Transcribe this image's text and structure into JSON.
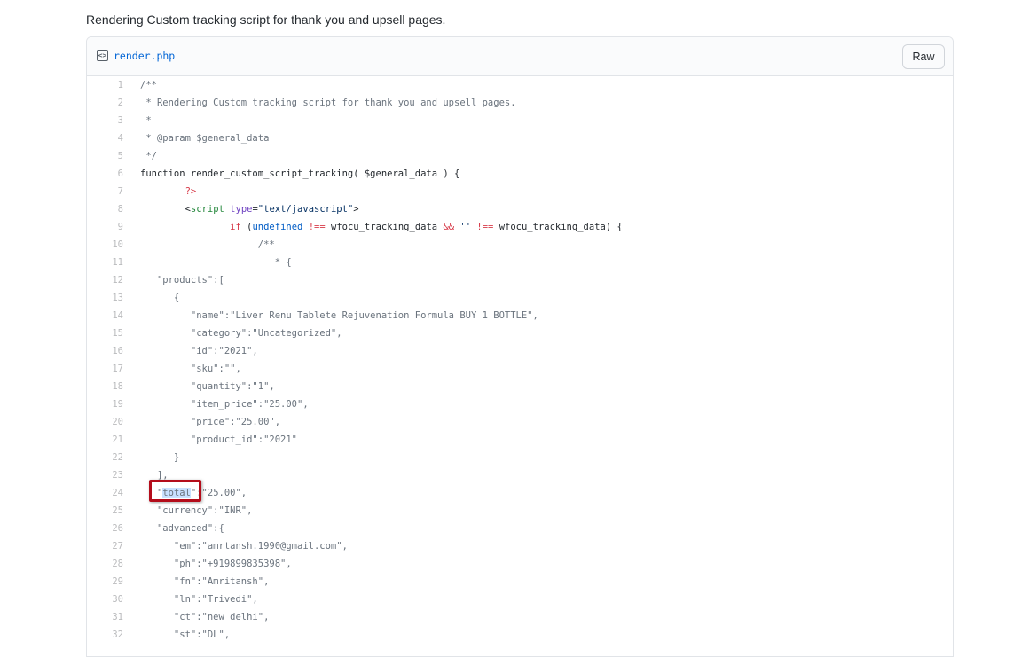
{
  "description": "Rendering Custom tracking script for thank you and upsell pages.",
  "file": {
    "icon": "code-file-icon",
    "name": "render.php",
    "raw_label": "Raw"
  },
  "lines": [
    {
      "n": "1",
      "t": "/**"
    },
    {
      "n": "2",
      "t": " * Rendering Custom tracking script for thank you and upsell pages."
    },
    {
      "n": "3",
      "t": " *"
    },
    {
      "n": "4",
      "t": " * @param $general_data"
    },
    {
      "n": "5",
      "t": " */"
    },
    {
      "n": "6",
      "t": "function render_custom_script_tracking( $general_data ) {"
    },
    {
      "n": "7",
      "t": "        ?>"
    },
    {
      "n": "8",
      "t": "        <script type=\"text/javascript\">"
    },
    {
      "n": "9",
      "t": "                if (undefined !== wfocu_tracking_data && '' !== wfocu_tracking_data) {"
    },
    {
      "n": "10",
      "t": "                     /**"
    },
    {
      "n": "11",
      "t": "                        * {"
    },
    {
      "n": "12",
      "t": "   \"products\":["
    },
    {
      "n": "13",
      "t": "      {"
    },
    {
      "n": "14",
      "t": "         \"name\":\"Liver Renu Tablete Rejuvenation Formula BUY 1 BOTTLE\","
    },
    {
      "n": "15",
      "t": "         \"category\":\"Uncategorized\","
    },
    {
      "n": "16",
      "t": "         \"id\":\"2021\","
    },
    {
      "n": "17",
      "t": "         \"sku\":\"\","
    },
    {
      "n": "18",
      "t": "         \"quantity\":\"1\","
    },
    {
      "n": "19",
      "t": "         \"item_price\":\"25.00\","
    },
    {
      "n": "20",
      "t": "         \"price\":\"25.00\","
    },
    {
      "n": "21",
      "t": "         \"product_id\":\"2021\""
    },
    {
      "n": "22",
      "t": "      }"
    },
    {
      "n": "23",
      "t": "   ],"
    },
    {
      "n": "24",
      "t": "   \"total\":\"25.00\","
    },
    {
      "n": "25",
      "t": "   \"currency\":\"INR\","
    },
    {
      "n": "26",
      "t": "   \"advanced\":{"
    },
    {
      "n": "27",
      "t": "      \"em\":\"amrtansh.1990@gmail.com\","
    },
    {
      "n": "28",
      "t": "      \"ph\":\"+919899835398\","
    },
    {
      "n": "29",
      "t": "      \"fn\":\"Amritansh\","
    },
    {
      "n": "30",
      "t": "      \"ln\":\"Trivedi\","
    },
    {
      "n": "31",
      "t": "      \"ct\":\"new delhi\","
    },
    {
      "n": "32",
      "t": "      \"st\":\"DL\","
    }
  ],
  "colors": {
    "link": "#0366d6",
    "highlight": "#c8e1ff",
    "annotation_box": "#b40d1b"
  }
}
